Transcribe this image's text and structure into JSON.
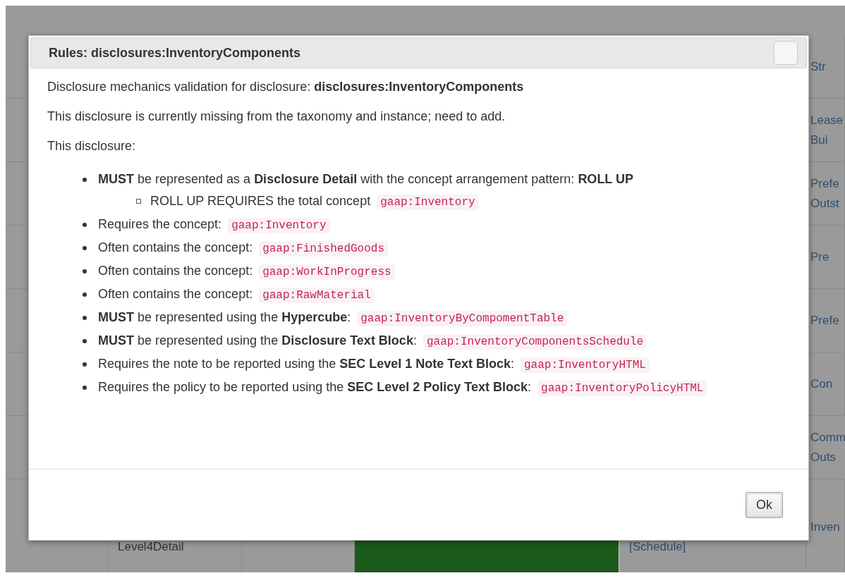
{
  "background_table": {
    "rows": [
      {
        "column_2": [],
        "column_5": [],
        "column_6": [
          "Str"
        ]
      },
      {
        "column_2": [],
        "column_5": [],
        "column_6": [
          "Lease",
          "Bui"
        ]
      },
      {
        "column_2": [],
        "column_5": [],
        "column_6": [
          "Prefe",
          "Outst"
        ]
      },
      {
        "column_2": [],
        "column_5": [],
        "column_6": [
          "Pre"
        ]
      },
      {
        "column_2": [],
        "column_5": [],
        "column_6": [
          "Prefe"
        ]
      },
      {
        "column_2": [],
        "column_5": [],
        "column_6": [
          "Con"
        ]
      },
      {
        "column_2": [],
        "column_5": [],
        "column_6": [
          "Comm",
          "Outs"
        ]
      },
      {
        "column_2": [
          "Level4Detail"
        ],
        "column_5": [
          "[Schedule]"
        ],
        "column_6": [
          "Inven"
        ]
      }
    ]
  },
  "dialog": {
    "title": "Rules: disclosures:InventoryComponents",
    "paragraphs": [
      "Disclosure mechanics validation for disclosure: **disclosures:InventoryComponents**",
      "This disclosure is currently missing from the taxonomy and instance; need to add.",
      "This disclosure:"
    ],
    "rules": [
      {
        "text": "**MUST** be represented as a **Disclosure Detail** with the concept arrangement pattern: **ROLL UP**",
        "children": [
          {
            "text": "ROLL UP REQUIRES the total concept",
            "code": "gaap:Inventory"
          }
        ]
      },
      {
        "text": "Requires the concept:",
        "code": "gaap:Inventory"
      },
      {
        "text": "Often contains the concept:",
        "code": "gaap:FinishedGoods"
      },
      {
        "text": "Often contains the concept:",
        "code": "gaap:WorkInProgress"
      },
      {
        "text": "Often contains the concept:",
        "code": "gaap:RawMaterial"
      },
      {
        "text": "**MUST** be represented using the **Hypercube**:",
        "code": "gaap:InventoryByCompomentTable"
      },
      {
        "text": "**MUST** be represented using the **Disclosure Text Block**:",
        "code": "gaap:InventoryComponentsSchedule"
      },
      {
        "text": "Requires the note to be reported using the **SEC Level 1 Note Text Block**:",
        "code": "gaap:InventoryHTML"
      },
      {
        "text": "Requires the policy to be reported using the **SEC Level 2 Policy Text Block**:",
        "code": "gaap:InventoryPolicyHTML"
      }
    ],
    "ok_button": "Ok"
  }
}
